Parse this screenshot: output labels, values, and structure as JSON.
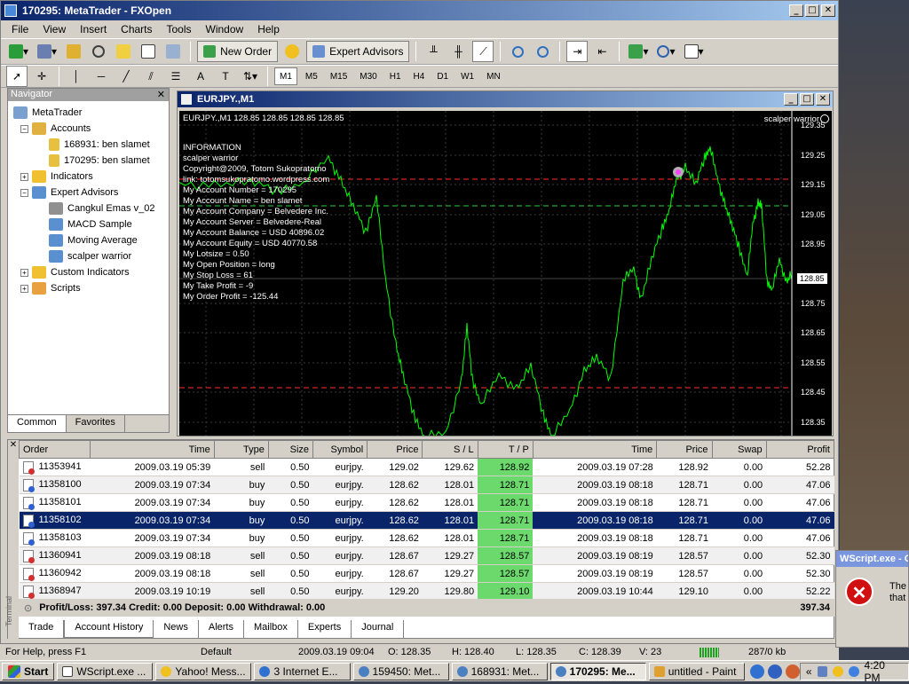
{
  "window": {
    "title": "170295: MetaTrader - FXOpen"
  },
  "menu": [
    "File",
    "View",
    "Insert",
    "Charts",
    "Tools",
    "Window",
    "Help"
  ],
  "toolbar": {
    "new_order": "New Order",
    "expert_advisors": "Expert Advisors"
  },
  "timeframes": [
    "M1",
    "M5",
    "M15",
    "M30",
    "H1",
    "H4",
    "D1",
    "W1",
    "MN"
  ],
  "navigator": {
    "title": "Navigator",
    "root": "MetaTrader",
    "accounts_label": "Accounts",
    "accounts": [
      "168931: ben slamet",
      "170295: ben slamet"
    ],
    "indicators_label": "Indicators",
    "experts_label": "Expert Advisors",
    "experts": [
      "Cangkul Emas v_02",
      "MACD Sample",
      "Moving Average",
      "scalper warrior"
    ],
    "custom_label": "Custom Indicators",
    "scripts_label": "Scripts",
    "tabs": [
      "Common",
      "Favorites"
    ]
  },
  "chart": {
    "title": "EURJPY.,M1",
    "header": "EURJPY.,M1  128.85 128.85 128.85 128.85",
    "ea_label": "scalper warrior",
    "current_price": "128.85",
    "price_labels": [
      "129.35",
      "129.25",
      "129.15",
      "129.05",
      "128.95",
      "128.75",
      "128.65",
      "128.55",
      "128.45",
      "128.35"
    ],
    "info_lines": [
      "INFORMATION",
      "scalper warrior",
      "Copyright@2009, Totom Sukopratomo",
      "link: totomsukopratomo.wordpress.com",
      "My Account Number = 170295",
      "My Account Name = ben slamet",
      "My Account Company = Belvedere Inc.",
      "My Account Server = Belvedere-Real",
      "My Account Balance = USD 40896.02",
      "My Account Equity = USD 40770.58",
      "My Lotsize = 0.50",
      "My Open Position = long",
      "My Stop Loss = 61",
      "My Take Profit = -9",
      "My Order Profit = -125.44"
    ]
  },
  "terminal": {
    "side_label": "Terminal",
    "columns": [
      "Order",
      "Time",
      "Type",
      "Size",
      "Symbol",
      "Price",
      "S / L",
      "T / P",
      "Time",
      "Price",
      "Swap",
      "Profit"
    ],
    "rows": [
      [
        "11353941",
        "2009.03.19 05:39",
        "sell",
        "0.50",
        "eurjpy.",
        "129.02",
        "129.62",
        "128.92",
        "2009.03.19 07:28",
        "128.92",
        "0.00",
        "52.28"
      ],
      [
        "11358100",
        "2009.03.19 07:34",
        "buy",
        "0.50",
        "eurjpy.",
        "128.62",
        "128.01",
        "128.71",
        "2009.03.19 08:18",
        "128.71",
        "0.00",
        "47.06"
      ],
      [
        "11358101",
        "2009.03.19 07:34",
        "buy",
        "0.50",
        "eurjpy.",
        "128.62",
        "128.01",
        "128.71",
        "2009.03.19 08:18",
        "128.71",
        "0.00",
        "47.06"
      ],
      [
        "11358102",
        "2009.03.19 07:34",
        "buy",
        "0.50",
        "eurjpy.",
        "128.62",
        "128.01",
        "128.71",
        "2009.03.19 08:18",
        "128.71",
        "0.00",
        "47.06"
      ],
      [
        "11358103",
        "2009.03.19 07:34",
        "buy",
        "0.50",
        "eurjpy.",
        "128.62",
        "128.01",
        "128.71",
        "2009.03.19 08:18",
        "128.71",
        "0.00",
        "47.06"
      ],
      [
        "11360941",
        "2009.03.19 08:18",
        "sell",
        "0.50",
        "eurjpy.",
        "128.67",
        "129.27",
        "128.57",
        "2009.03.19 08:19",
        "128.57",
        "0.00",
        "52.30"
      ],
      [
        "11360942",
        "2009.03.19 08:18",
        "sell",
        "0.50",
        "eurjpy.",
        "128.67",
        "129.27",
        "128.57",
        "2009.03.19 08:19",
        "128.57",
        "0.00",
        "52.30"
      ],
      [
        "11368947",
        "2009.03.19 10:19",
        "sell",
        "0.50",
        "eurjpy.",
        "129.20",
        "129.80",
        "129.10",
        "2009.03.19 10:44",
        "129.10",
        "0.00",
        "52.22"
      ]
    ],
    "selected_row": 3,
    "summary": "Profit/Loss: 397.34  Credit: 0.00  Deposit: 0.00  Withdrawal: 0.00",
    "total": "397.34",
    "tabs": [
      "Trade",
      "Account History",
      "News",
      "Alerts",
      "Mailbox",
      "Experts",
      "Journal"
    ],
    "active_tab": "Account History"
  },
  "status": {
    "help": "For Help, press F1",
    "profile": "Default",
    "datetime": "2009.03.19 09:04",
    "open": "O: 128.35",
    "high": "H: 128.40",
    "low": "L: 128.35",
    "close": "C: 128.39",
    "volume": "V: 23",
    "traffic": "287/0 kb"
  },
  "taskbar": {
    "start": "Start",
    "tasks": [
      "WScript.exe ...",
      "Yahoo! Mess...",
      "3 Internet E...",
      "159450: Met...",
      "168931: Met...",
      "170295: Me...",
      "untitled - Paint"
    ],
    "active_task": 5,
    "clock": "4:20 PM"
  },
  "dialog": {
    "title": "WScript.exe - C",
    "text": "The that"
  },
  "colors": {
    "chart_line": "#00ff00",
    "tp_cell": "#6bd96b",
    "selected_row": "#0a246a",
    "red_level": "#ff3030",
    "green_level": "#33cc33"
  }
}
